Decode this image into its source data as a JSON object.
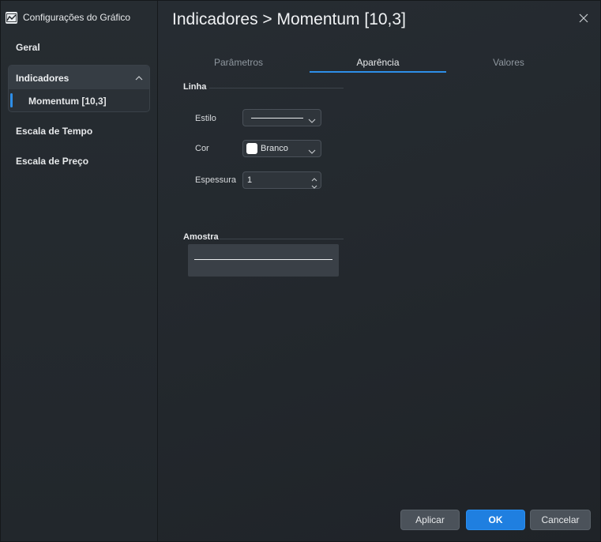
{
  "window": {
    "title": "Configurações do Gráfico"
  },
  "sidebar": {
    "items": [
      {
        "label": "Geral"
      },
      {
        "label": "Indicadores",
        "expanded": true,
        "children": [
          {
            "label": "Momentum [10,3]",
            "selected": true
          }
        ]
      },
      {
        "label": "Escala de Tempo"
      },
      {
        "label": "Escala de Preço"
      }
    ]
  },
  "header": {
    "title": "Indicadores > Momentum [10,3]"
  },
  "tabs": [
    {
      "label": "Parâmetros",
      "active": false
    },
    {
      "label": "Aparência",
      "active": true
    },
    {
      "label": "Valores",
      "active": false
    }
  ],
  "linha": {
    "title": "Linha",
    "estilo": {
      "label": "Estilo",
      "value": "solid"
    },
    "cor": {
      "label": "Cor",
      "value": "Branco",
      "swatch": "#ffffff"
    },
    "espessura": {
      "label": "Espessura",
      "value": "1"
    }
  },
  "amostra": {
    "title": "Amostra"
  },
  "buttons": {
    "apply": "Aplicar",
    "ok": "OK",
    "cancel": "Cancelar"
  },
  "colors": {
    "accent": "#2e8ee8",
    "ok_button": "#1f7fe0"
  },
  "icons": {
    "app": "chart-icon",
    "close": "close-icon",
    "collapse": "chevron-up-icon",
    "dropdown": "chevron-down-icon",
    "spinner": "spinner-arrows-icon"
  }
}
